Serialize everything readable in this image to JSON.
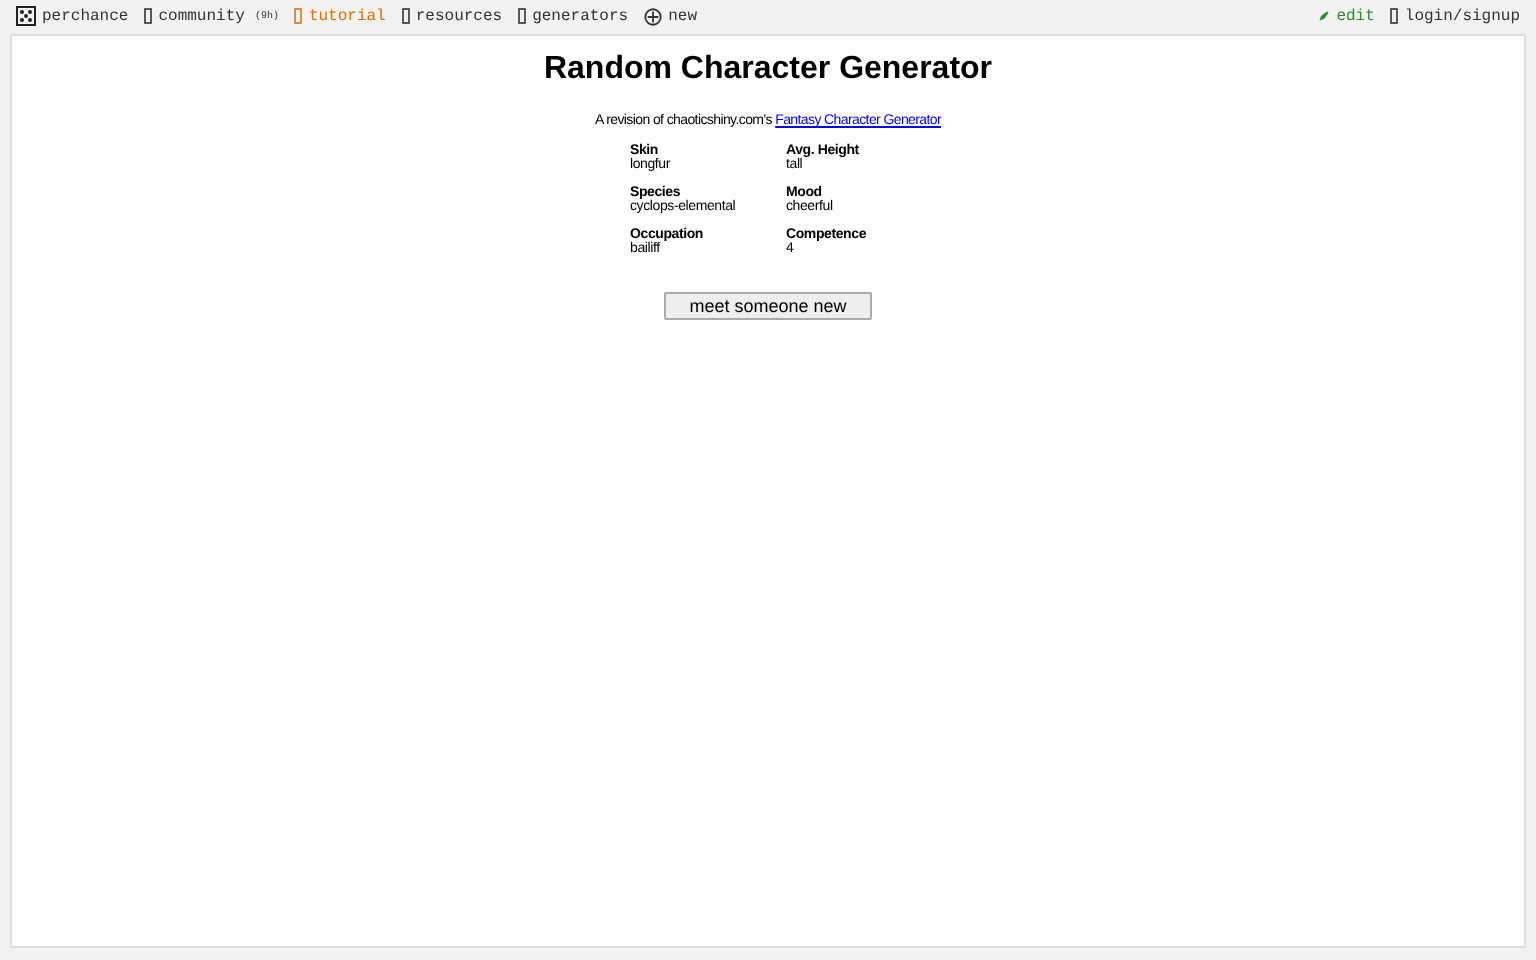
{
  "nav_left": [
    {
      "label": "perchance",
      "kind": "dice",
      "color": "#333333"
    },
    {
      "label": "community",
      "badge": "(9h)",
      "kind": "box",
      "color": "#333333"
    },
    {
      "label": "tutorial",
      "kind": "box",
      "color": "#e07000"
    },
    {
      "label": "resources",
      "kind": "box",
      "color": "#333333"
    },
    {
      "label": "generators",
      "kind": "box",
      "color": "#333333"
    },
    {
      "label": "new",
      "kind": "plus",
      "color": "#333333"
    }
  ],
  "nav_right": [
    {
      "label": "edit",
      "kind": "pencil",
      "color": "#2e8b2e"
    },
    {
      "label": "login/signup",
      "kind": "box",
      "color": "#333333"
    }
  ],
  "title": "Random Character Generator",
  "subtitle": {
    "text": "A revision of chaoticshiny.com's ",
    "link": "Fantasy Character Generator"
  },
  "traits": [
    {
      "label": "Skin",
      "value": "longfur"
    },
    {
      "label": "Avg. Height",
      "value": "tall"
    },
    {
      "label": "Species",
      "value": "cyclops-elemental"
    },
    {
      "label": "Mood",
      "value": "cheerful"
    },
    {
      "label": "Occupation",
      "value": "bailiff"
    },
    {
      "label": "Competence",
      "value": "4"
    }
  ],
  "button": "meet someone new"
}
